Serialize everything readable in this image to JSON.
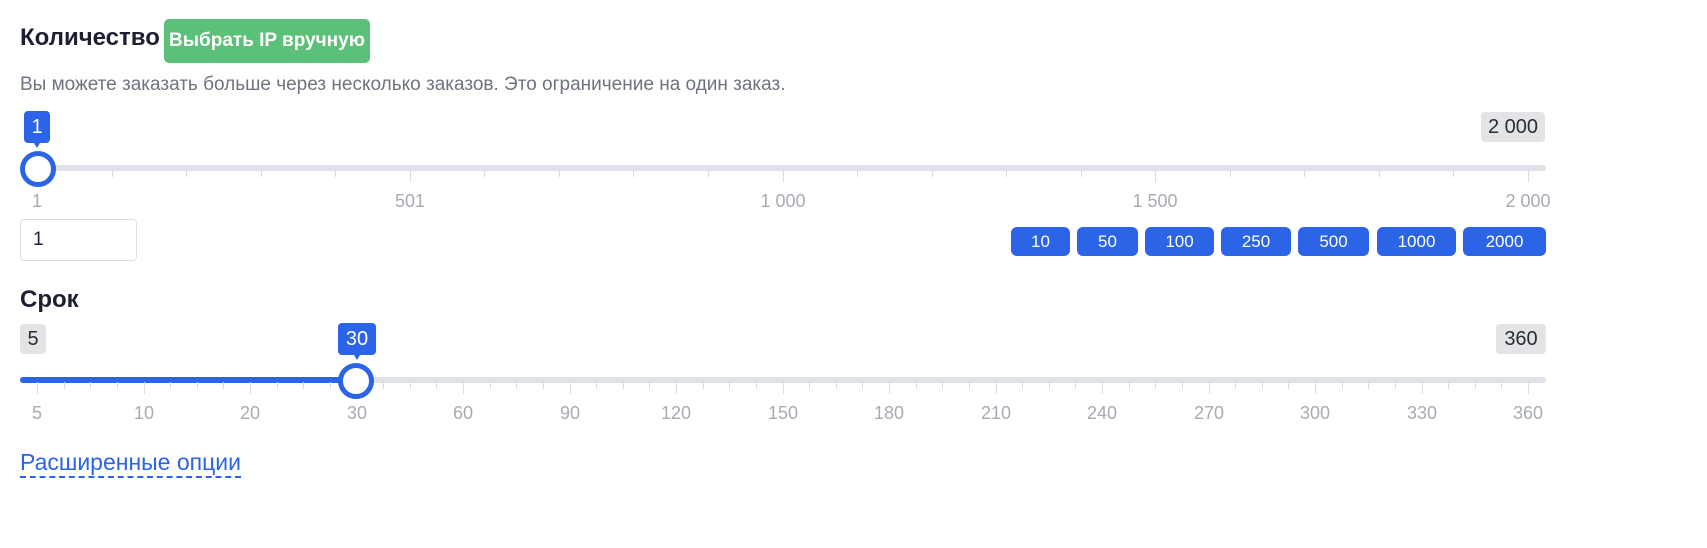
{
  "quantity": {
    "title": "Количество",
    "manual_ip_button": "Выбрать IP вручную",
    "hint": "Вы можете заказать больше через несколько заказов. Это ограничение на один заказ.",
    "slider": {
      "min": 1,
      "max": 2000,
      "value": 1,
      "value_label": "1",
      "max_label": "2 000"
    },
    "scale_labels": [
      "1",
      "501",
      "1 000",
      "1 500",
      "2 000"
    ],
    "input_value": "1",
    "presets": [
      "10",
      "50",
      "100",
      "250",
      "500",
      "1000",
      "2000"
    ]
  },
  "term": {
    "title": "Срок",
    "slider": {
      "min": 5,
      "max": 360,
      "value": 30,
      "value_label": "30",
      "min_label": "5",
      "max_label": "360"
    },
    "scale_labels": [
      "5",
      "10",
      "20",
      "30",
      "60",
      "90",
      "120",
      "150",
      "180",
      "210",
      "240",
      "270",
      "300",
      "330",
      "360"
    ]
  },
  "advanced_link": "Расширенные опции",
  "colors": {
    "accent": "#2b64e6",
    "green": "#5cc178",
    "track": "#dfe2e8"
  }
}
